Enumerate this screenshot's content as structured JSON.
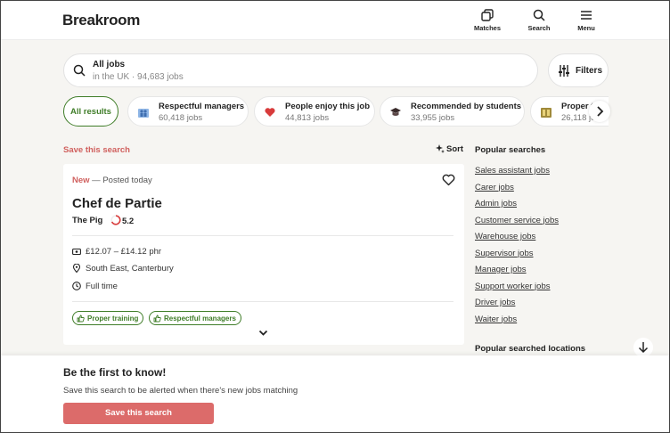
{
  "header": {
    "logo": "Breakroom",
    "nav": [
      {
        "label": "Matches",
        "icon": "copy-squares-icon"
      },
      {
        "label": "Search",
        "icon": "search-icon"
      },
      {
        "label": "Menu",
        "icon": "hamburger-icon"
      }
    ]
  },
  "search": {
    "title": "All jobs",
    "subtitle": "in the UK · 94,683 jobs",
    "filters_label": "Filters"
  },
  "chips": [
    {
      "label": "All results",
      "selected": true
    },
    {
      "title": "Respectful managers",
      "count": "60,418 jobs",
      "icon": "people-icon"
    },
    {
      "title": "People enjoy this job",
      "count": "44,813 jobs",
      "icon": "heart-icon"
    },
    {
      "title": "Recommended by students",
      "count": "33,955 jobs",
      "icon": "graduation-cap-icon"
    },
    {
      "title": "Proper t",
      "count": "26,118 jo",
      "icon": "training-icon"
    }
  ],
  "results": {
    "save_search": "Save this search",
    "sort_label": "Sort"
  },
  "job": {
    "status": "New",
    "posted": " — Posted today",
    "title": "Chef de Partie",
    "company": "The Pig",
    "rating": "5.2",
    "pay": "£12.07 – £14.12 phr",
    "location": "South East, Canterbury",
    "type": "Full time",
    "tags": [
      "Proper training",
      "Respectful managers"
    ]
  },
  "popular": {
    "heading": "Popular searches",
    "items": [
      "Sales assistant jobs",
      "Carer jobs",
      "Admin jobs",
      "Customer service jobs",
      "Warehouse jobs",
      "Supervisor jobs",
      "Manager jobs",
      "Support worker jobs",
      "Driver jobs",
      "Waiter jobs"
    ],
    "locations_heading": "Popular searched locations"
  },
  "alert": {
    "title": "Be the first to know!",
    "text": "Save this search to be alerted when there's new jobs matching",
    "button": "Save this search"
  },
  "colors": {
    "accent_green": "#3f7d28",
    "accent_red": "#d0605e",
    "button_red": "#dc6b6a",
    "background": "#f6f5f2"
  }
}
